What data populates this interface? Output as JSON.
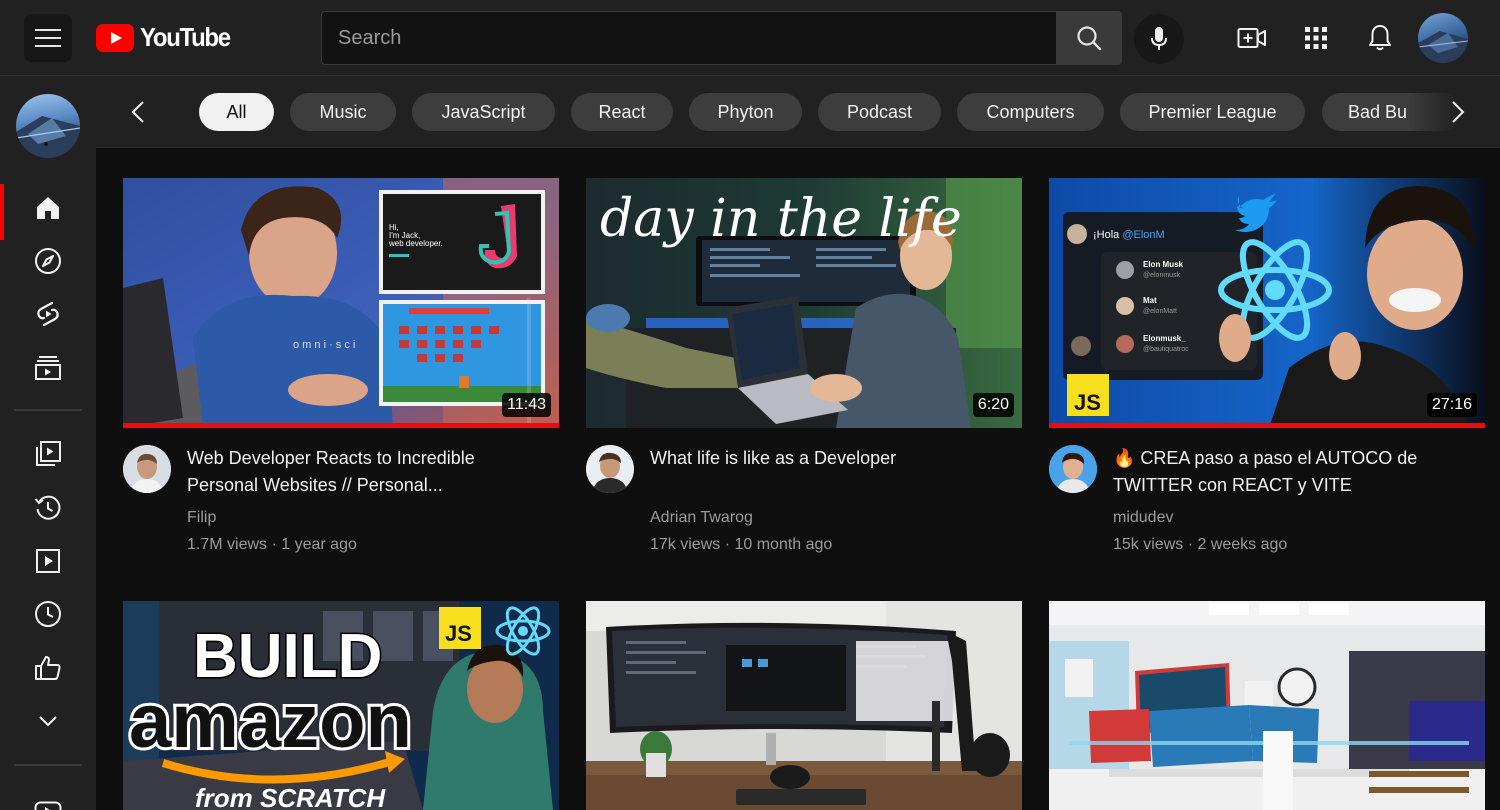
{
  "header": {
    "logo_text": "YouTube",
    "search_placeholder": "Search",
    "icons": [
      "menu-icon",
      "search-icon",
      "mic-icon",
      "create-video-icon",
      "apps-grid-icon",
      "notifications-bell-icon"
    ],
    "brand_color": "#ff0000"
  },
  "sidebar": {
    "items": [
      {
        "name": "home-icon",
        "active": true
      },
      {
        "name": "explore-icon"
      },
      {
        "name": "shorts-icon"
      },
      {
        "name": "subscriptions-icon"
      },
      {
        "name": "library-icon"
      },
      {
        "name": "history-icon"
      },
      {
        "name": "your-videos-icon"
      },
      {
        "name": "watch-later-icon"
      },
      {
        "name": "liked-videos-icon"
      },
      {
        "name": "show-more-icon"
      }
    ]
  },
  "chips": [
    {
      "label": "All",
      "active": true
    },
    {
      "label": "Music"
    },
    {
      "label": "JavaScript"
    },
    {
      "label": "React"
    },
    {
      "label": "Phyton"
    },
    {
      "label": "Podcast"
    },
    {
      "label": "Computers"
    },
    {
      "label": "Premier League"
    },
    {
      "label": "Bad Bu"
    }
  ],
  "videos": [
    {
      "title": "Web Developer Reacts to Incredible Personal Websites // Personal...",
      "channel": "Filip",
      "views": "1.7M views",
      "age": "1 year ago",
      "duration": "11:43",
      "thumb_text": {
        "line1": "Hi,",
        "line2": "I'm Jack,",
        "line3": "web developer."
      }
    },
    {
      "title": "What life is like as a Developer",
      "channel": "Adrian Twarog",
      "views": "17k views",
      "age": "10 month ago",
      "duration": "6:20",
      "thumb_text": {
        "script": "day in the life"
      }
    },
    {
      "title": "🔥 CREA paso a paso el AUTOCO de TWITTER con REACT y VITE",
      "channel": "midudev",
      "views": "15k views",
      "age": "2 weeks ago",
      "duration": "27:16",
      "thumb_text": {
        "hola": "¡Hola",
        "mention": "@ElonM",
        "users": [
          {
            "name": "Elon Musk",
            "handle": "@elonmusk"
          },
          {
            "name": "Mat",
            "handle": "@elonMatt"
          },
          {
            "name": "Elonmusk_",
            "handle": "@bautiquatroc"
          }
        ],
        "badge": "JS"
      }
    },
    {
      "thumb_text": {
        "line1": "BUILD",
        "line2": "amazon",
        "line3": "from SCRATCH",
        "badge": "JS"
      }
    },
    {
      "thumb_text": {}
    },
    {
      "thumb_text": {}
    }
  ]
}
